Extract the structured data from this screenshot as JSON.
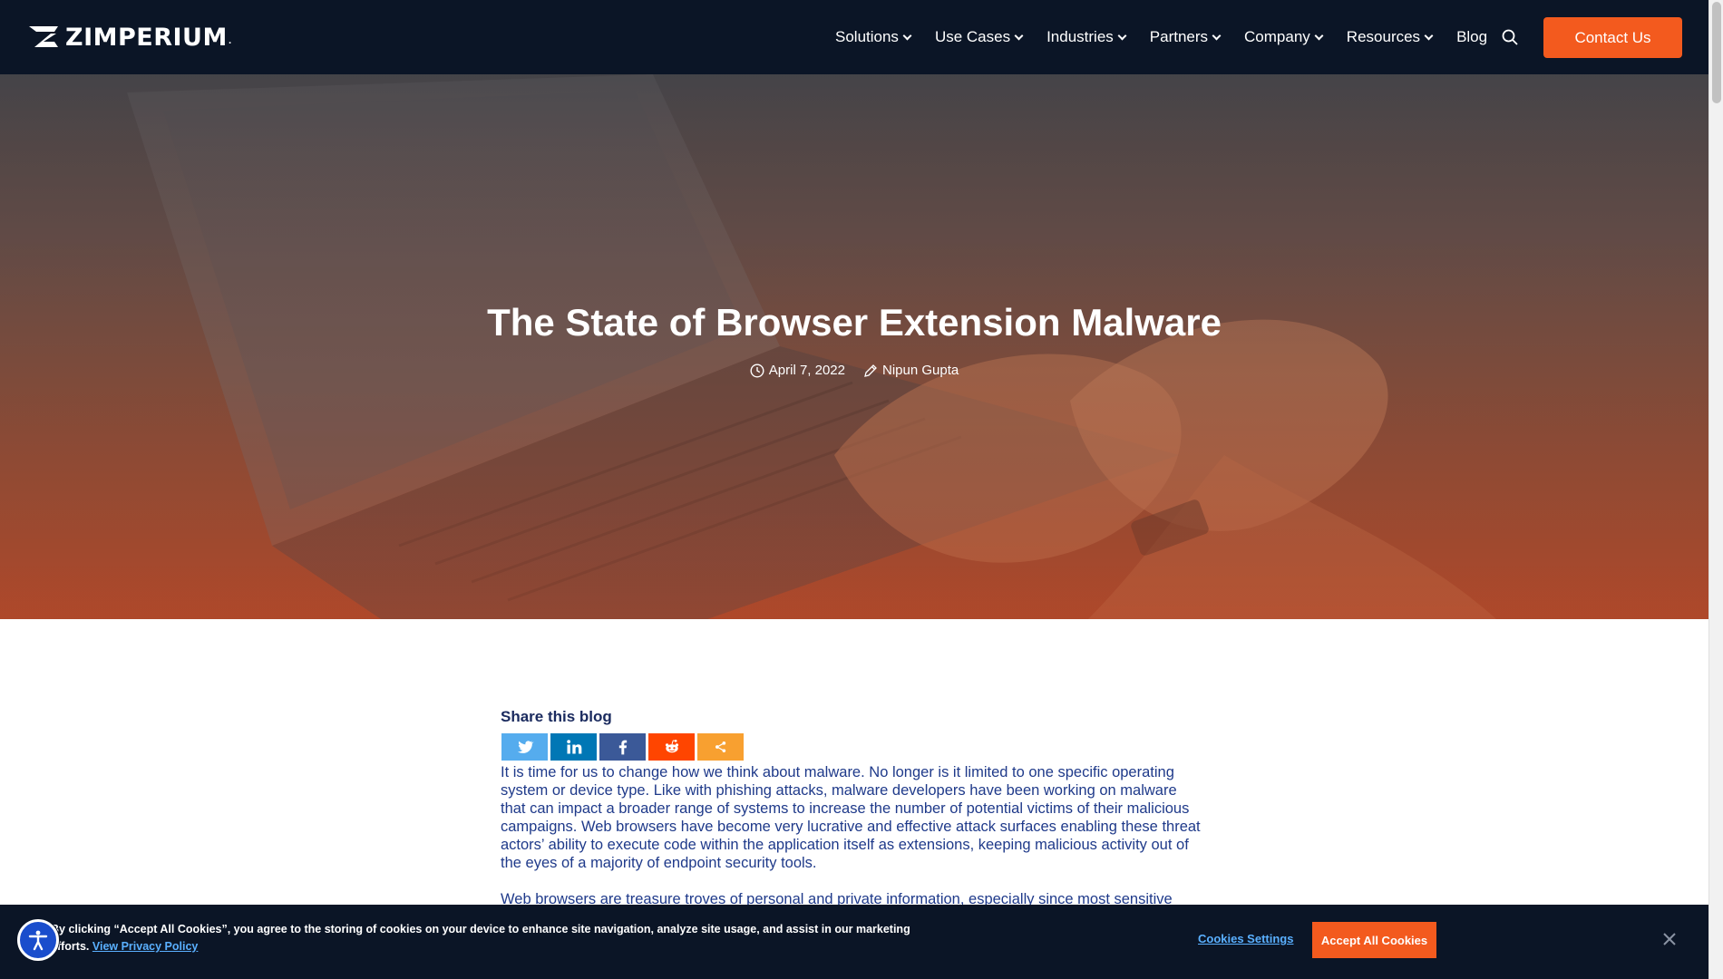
{
  "brand": {
    "name": "ZIMPERIUM",
    "trademark": ".",
    "accent_color": "#f35a1e",
    "nav_bg": "#0b1526"
  },
  "nav": {
    "items": [
      {
        "label": "Solutions",
        "has_dropdown": true
      },
      {
        "label": "Use Cases",
        "has_dropdown": true
      },
      {
        "label": "Industries",
        "has_dropdown": true
      },
      {
        "label": "Partners",
        "has_dropdown": true
      },
      {
        "label": "Company",
        "has_dropdown": true
      },
      {
        "label": "Resources",
        "has_dropdown": true
      },
      {
        "label": "Blog",
        "has_dropdown": false
      }
    ],
    "search_icon": "search-icon",
    "contact_label": "Contact Us"
  },
  "hero": {
    "title": "The State of Browser Extension Malware",
    "date": "April 7, 2022",
    "author": "Nipun Gupta",
    "date_icon": "clock-icon",
    "author_icon": "pencil-icon"
  },
  "article": {
    "share_title": "Share this blog",
    "share_buttons": [
      {
        "name": "twitter-icon",
        "color": "#55acee"
      },
      {
        "name": "linkedin-icon",
        "color": "#0077b5"
      },
      {
        "name": "facebook-icon",
        "color": "#3b5998"
      },
      {
        "name": "reddit-icon",
        "color": "#ff4500"
      },
      {
        "name": "more-icon",
        "color": "#f8a030"
      }
    ],
    "paragraph1": "It is time for us to change how we think about malware. No longer is it limited to one specific operating system or device type. Like with phishing attacks, malware developers have been working on malware that can impact a broader range of systems to increase the number of potential victims of their malicious campaigns. Web browsers have become very lucrative and effective attack surfaces enabling these threat actors’ ability to execute code within the application itself as extensions, keeping malicious activity out of the eyes of a majority of endpoint security tools.",
    "paragraph2": "Web browsers are treasure troves of personal and private information, especially since most sensitive data"
  },
  "cookie": {
    "text": "By clicking “Accept All Cookies”, you agree to the storing of cookies on your device to enhance site navigation, analyze site usage, and assist in our marketing efforts.",
    "link_label": "View Privacy Policy",
    "settings_label": "Cookies Settings",
    "accept_label": "Accept All Cookies",
    "close_icon": "close-icon"
  },
  "accessibility": {
    "icon": "accessibility-icon"
  }
}
